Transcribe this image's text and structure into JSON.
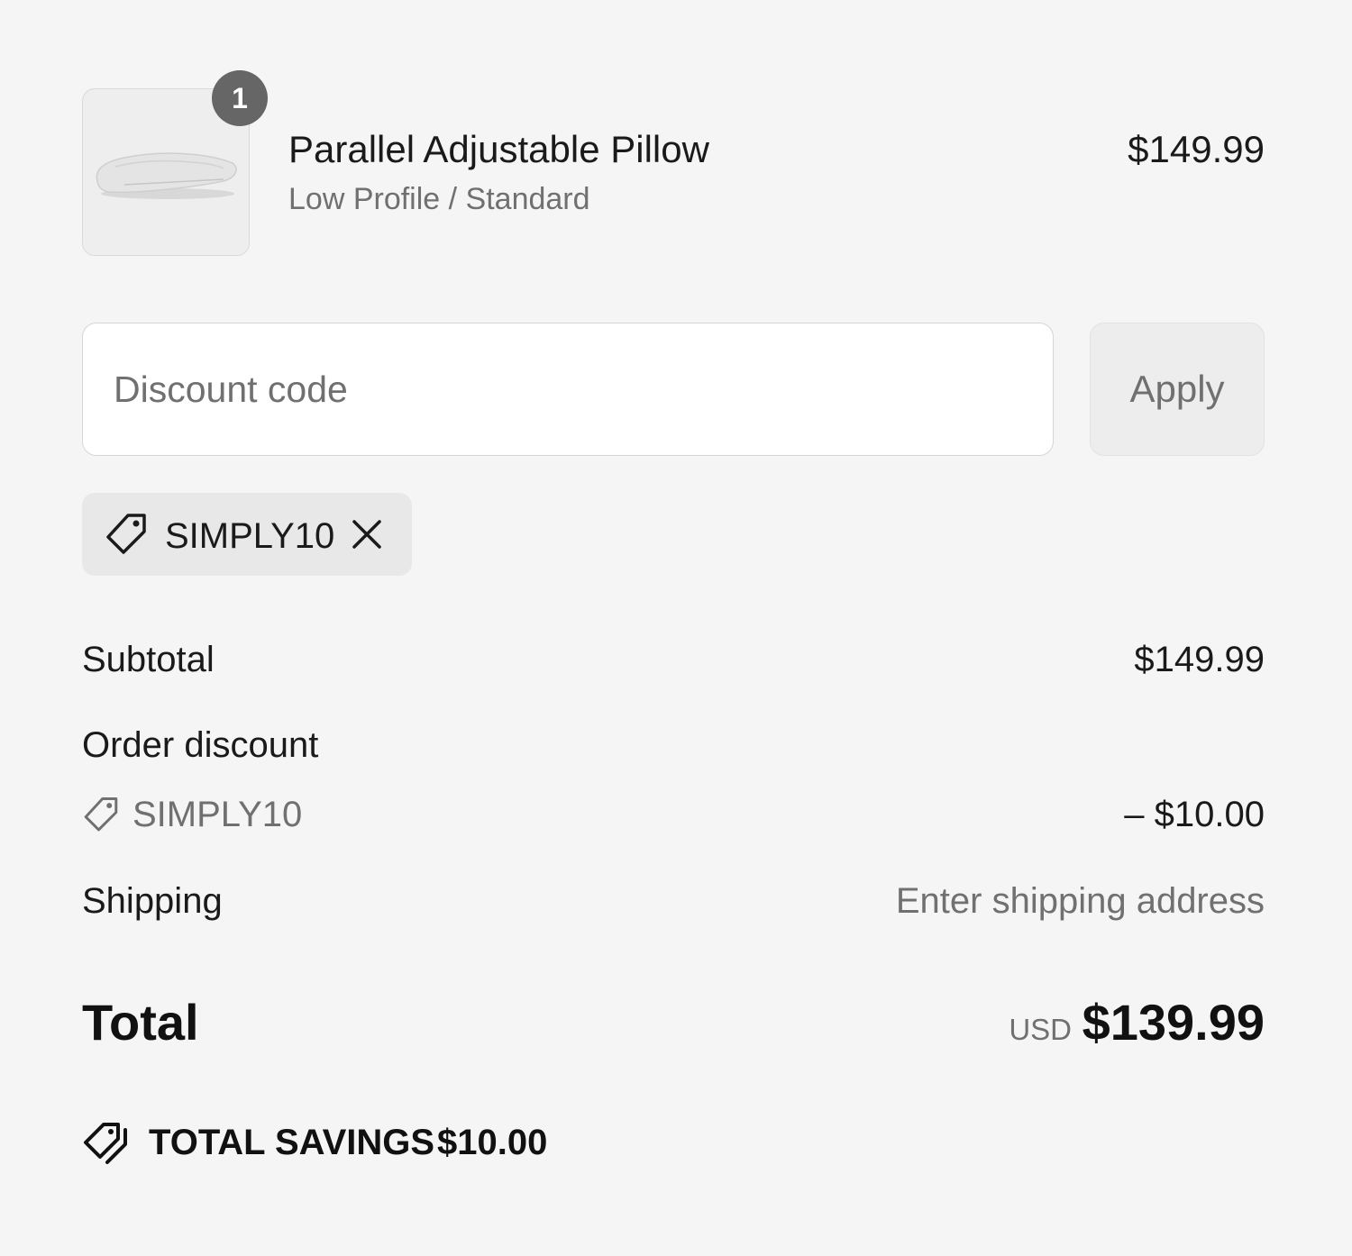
{
  "line_item": {
    "quantity": "1",
    "name": "Parallel Adjustable Pillow",
    "variant": "Low Profile / Standard",
    "price": "$149.99",
    "image_icon": "pillow-image"
  },
  "discount": {
    "placeholder": "Discount code",
    "value": "",
    "apply_label": "Apply",
    "applied_code": "SIMPLY10",
    "tag_icon": "tag-icon",
    "remove_icon": "close-icon"
  },
  "totals": {
    "subtotal_label": "Subtotal",
    "subtotal_value": "$149.99",
    "order_discount_label": "Order discount",
    "discount_code": "SIMPLY10",
    "discount_value": "– $10.00",
    "shipping_label": "Shipping",
    "shipping_value": "Enter shipping address",
    "total_label": "Total",
    "currency": "USD",
    "total_value": "$139.99"
  },
  "savings": {
    "label": "TOTAL SAVINGS",
    "value": "$10.00",
    "icon": "tags-icon"
  },
  "colors": {
    "background": "#f5f5f5",
    "text": "#1a1a1a",
    "muted": "#707070",
    "badge": "#666666"
  }
}
